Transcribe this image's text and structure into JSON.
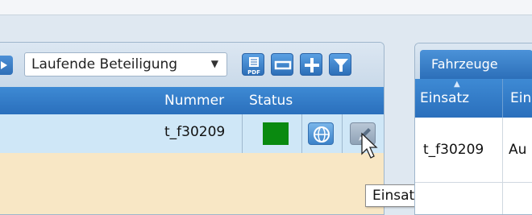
{
  "toolbar": {
    "filter_select": {
      "selected": "Laufende Beteiligung"
    },
    "buttons": [
      "pdf-icon",
      "minimize-icon",
      "plus-icon",
      "filter-icon"
    ]
  },
  "grid": {
    "columns": [
      "Nummer",
      "Status"
    ],
    "rows": [
      {
        "nummer": "t_f30209",
        "status_color": "#0a8a10"
      }
    ]
  },
  "tooltip": {
    "text": "Einsatz editieren"
  },
  "right_panel": {
    "tab": "Fahrzeuge",
    "columns": [
      "Einsatz",
      "Ein"
    ],
    "rows": [
      {
        "einsatz": "t_f30209",
        "col2": "Au"
      }
    ]
  },
  "colors": {
    "accent": "#2f7ac7",
    "row_selected": "#cfe7f7",
    "empty_area": "#f8e7c5",
    "status_green": "#0a8a10"
  }
}
